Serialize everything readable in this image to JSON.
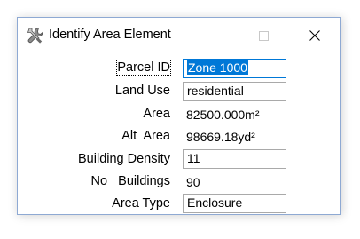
{
  "window": {
    "title": "Identify Area Element",
    "icon": "tools-icon",
    "controls": {
      "minimize": "minimize-icon",
      "maximize": "maximize-icon",
      "close": "close-icon"
    }
  },
  "fields": {
    "parcel_id": {
      "label": "Parcel ID",
      "value": "Zone 1000"
    },
    "land_use": {
      "label": "Land Use",
      "value": "residential"
    },
    "area": {
      "label": "Area",
      "value": "82500.000m²"
    },
    "alt_area": {
      "label": "Alt  Area",
      "value": "98669.18yd²"
    },
    "building_density": {
      "label": "Building Density",
      "value": "11"
    },
    "no_buildings": {
      "label": "No_ Buildings",
      "value": "90"
    },
    "area_type": {
      "label": "Area Type",
      "value": "Enclosure"
    }
  },
  "colors": {
    "selection": "#0078d7",
    "window_border": "#8ea9d3",
    "field_border": "#a9a9a9"
  }
}
